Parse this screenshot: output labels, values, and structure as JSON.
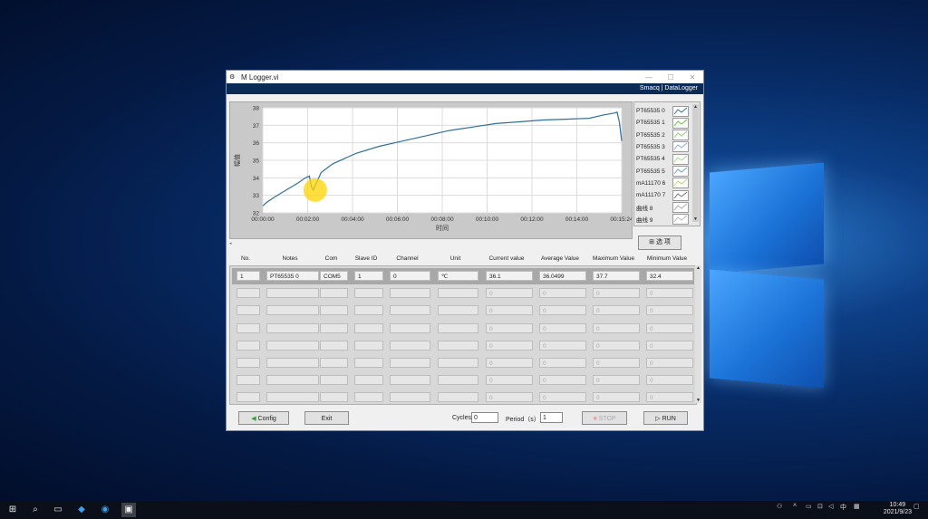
{
  "window": {
    "title": "M Logger.vi",
    "brand": "Smacq | DataLogger"
  },
  "chart_data": {
    "type": "line",
    "xlabel": "时间",
    "ylabel": "幅值",
    "ylim": [
      32,
      38
    ],
    "xlim_seconds": [
      0,
      924
    ],
    "x_ticks": [
      "00:00:00",
      "00:02:00",
      "00:04:00",
      "00:06:00",
      "00:08:00",
      "00:10:00",
      "00:12:00",
      "00:14:00",
      "00:15:24"
    ],
    "y_ticks": [
      "32",
      "33",
      "34",
      "35",
      "36",
      "37",
      "38"
    ],
    "grid": true,
    "series": [
      {
        "name": "PT65535 0",
        "color": "#2f6fa0",
        "x": [
          0,
          10,
          30,
          60,
          90,
          110,
          120,
          125,
          130,
          140,
          150,
          180,
          240,
          300,
          360,
          420,
          480,
          540,
          600,
          660,
          720,
          780,
          840,
          880,
          905,
          912,
          918,
          924
        ],
        "y": [
          32.4,
          32.6,
          32.9,
          33.3,
          33.7,
          34.0,
          34.1,
          33.5,
          33.3,
          33.8,
          34.3,
          34.8,
          35.4,
          35.8,
          36.1,
          36.4,
          36.7,
          36.9,
          37.1,
          37.2,
          37.3,
          37.35,
          37.4,
          37.6,
          37.7,
          37.75,
          37.2,
          36.1
        ]
      }
    ]
  },
  "legend": {
    "items": [
      "PT65535 0",
      "PT65535 1",
      "PT65535 2",
      "PT65535 3",
      "PT65535 4",
      "PT65535 5",
      "mA11170 6",
      "mA11170 7",
      "曲线 8",
      "曲线 9"
    ],
    "colors": [
      "#2f6fa0",
      "#6bbf4a",
      "#8fd06f",
      "#8aa8d8",
      "#a8d890",
      "#6aa0c0",
      "#c8d070",
      "#777777",
      "#aaaaaa",
      "#bbbbbb"
    ],
    "control_label": "选 项"
  },
  "table": {
    "headers": [
      "No.",
      "Notes",
      "Com",
      "Slave ID",
      "Channel",
      "Unit",
      "Current value",
      "Average Value",
      "Maximum Value",
      "Minimum Value"
    ],
    "rows": [
      [
        "1",
        "PT65535 0",
        "COM5",
        "1",
        "0",
        "℃",
        "36.1",
        "36.0499",
        "37.7",
        "32.4"
      ],
      [
        "",
        "",
        "",
        "",
        "",
        "",
        "0",
        "0",
        "0",
        "0"
      ],
      [
        "",
        "",
        "",
        "",
        "",
        "",
        "0",
        "0",
        "0",
        "0"
      ],
      [
        "",
        "",
        "",
        "",
        "",
        "",
        "0",
        "0",
        "0",
        "0"
      ],
      [
        "",
        "",
        "",
        "",
        "",
        "",
        "0",
        "0",
        "0",
        "0"
      ],
      [
        "",
        "",
        "",
        "",
        "",
        "",
        "0",
        "0",
        "0",
        "0"
      ],
      [
        "",
        "",
        "",
        "",
        "",
        "",
        "0",
        "0",
        "0",
        "0"
      ],
      [
        "",
        "",
        "",
        "",
        "",
        "",
        "0",
        "0",
        "0",
        "0"
      ]
    ]
  },
  "bottom": {
    "config_label": "Config",
    "exit_label": "Exit",
    "cycles_label": "Cycles",
    "cycles_value": "0",
    "period_label": "Period（s）",
    "period_value": "1",
    "stop_label": "STOP",
    "run_label": "RUN"
  },
  "taskbar": {
    "ime": "中",
    "time": "10:49",
    "date": "2021/9/23"
  }
}
